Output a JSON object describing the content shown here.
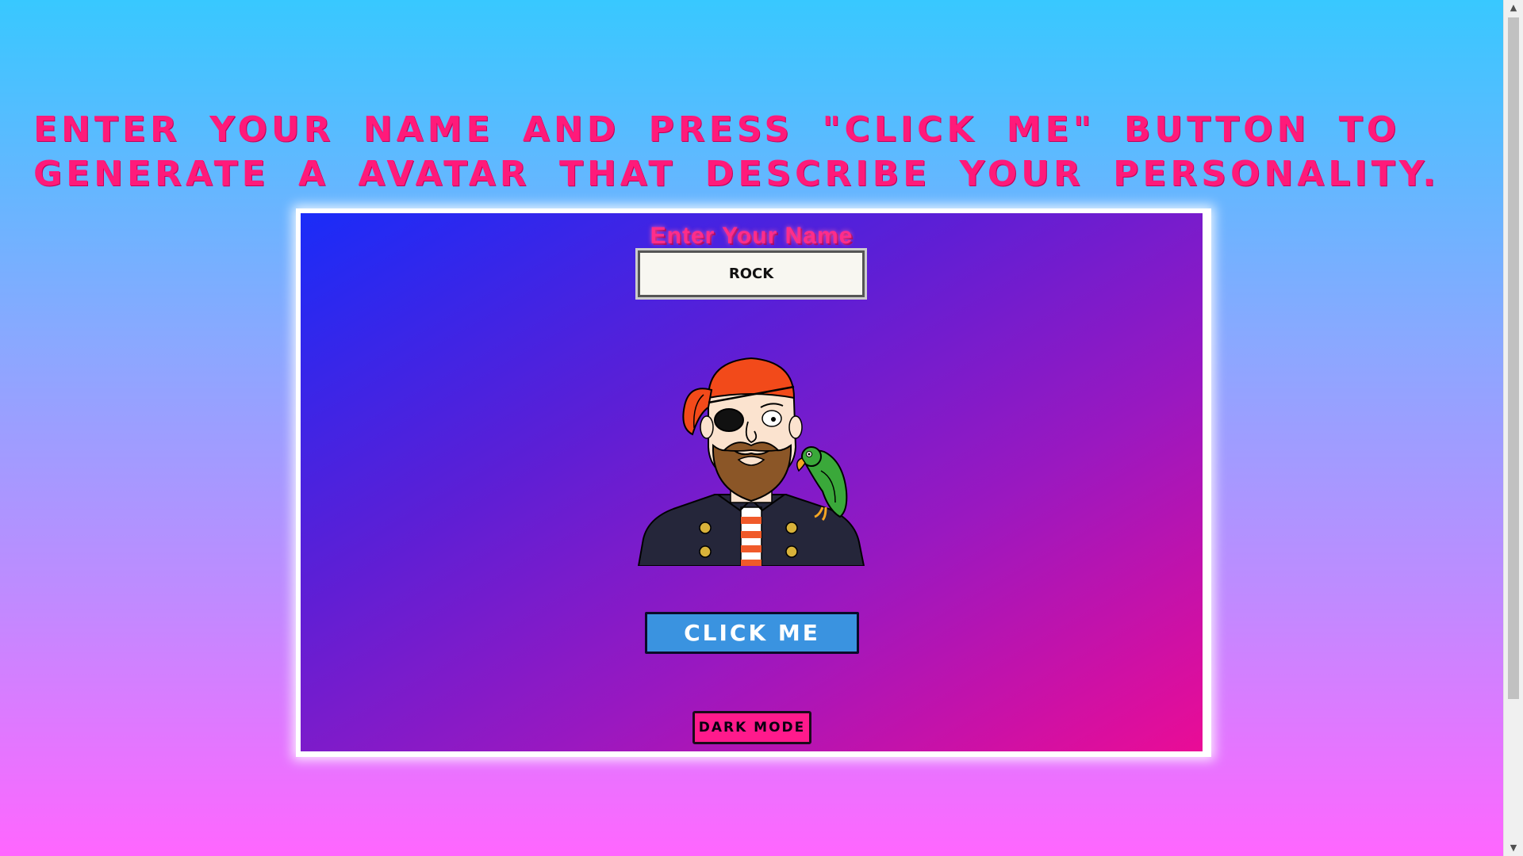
{
  "instructions": {
    "text": "Enter your name and press \"Click me\" button to generate a avatar that describe your personality."
  },
  "form": {
    "label": "Enter Your Name",
    "name_value": "Rock",
    "click_button_label": "Click me",
    "dark_mode_button_label": "Dark mode"
  },
  "avatar": {
    "description": "pirate"
  },
  "colors": {
    "headline": "#ff1a7a",
    "card_gradient_start": "#1a2cf8",
    "card_gradient_end": "#ea0c96",
    "click_button": "#3a93e0",
    "dark_mode_button": "#ff1a8c"
  },
  "icons": {
    "scroll_up": "scroll-up-arrow-icon",
    "scroll_down": "scroll-down-arrow-icon"
  }
}
